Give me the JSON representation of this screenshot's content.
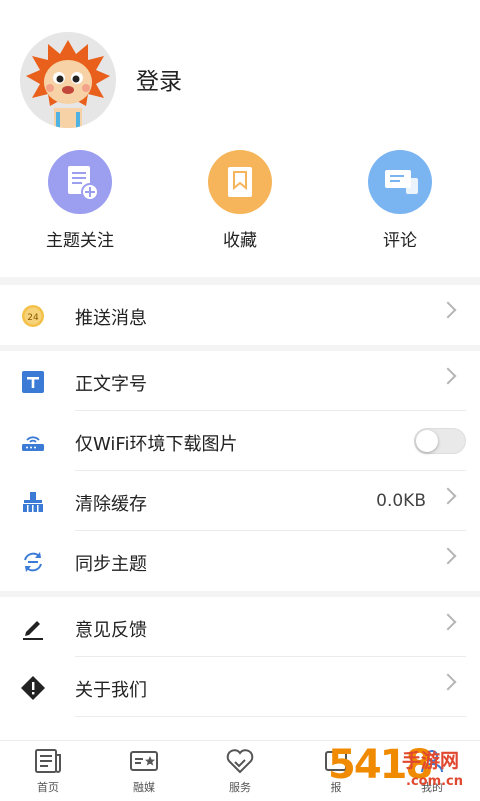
{
  "profile": {
    "login_label": "登录"
  },
  "quick_actions": [
    {
      "label": "主题关注",
      "icon": "document-add-icon",
      "color": "#9c9ef0"
    },
    {
      "label": "收藏",
      "icon": "bookmark-icon",
      "color": "#f6b55a"
    },
    {
      "label": "评论",
      "icon": "chat-icon",
      "color": "#7ab5f2"
    }
  ],
  "settings": {
    "push": {
      "label": "推送消息",
      "icon": "clock-24-icon"
    },
    "font_size": {
      "label": "正文字号",
      "icon": "text-t-icon"
    },
    "wifi_only": {
      "label": "仅WiFi环境下载图片",
      "icon": "router-icon",
      "enabled": false
    },
    "clear_cache": {
      "label": "清除缓存",
      "value": "0.0KB",
      "icon": "broom-icon"
    },
    "sync_theme": {
      "label": "同步主题",
      "icon": "sync-icon"
    },
    "feedback": {
      "label": "意见反馈",
      "icon": "pencil-icon"
    },
    "about": {
      "label": "关于我们",
      "icon": "warning-diamond-icon"
    }
  },
  "tabs": [
    {
      "label": "首页",
      "icon": "newspaper-icon"
    },
    {
      "label": "融媒",
      "icon": "media-card-icon"
    },
    {
      "label": "服务",
      "icon": "heart-service-icon"
    },
    {
      "label": "报",
      "icon": "report-icon"
    },
    {
      "label": "我的",
      "icon": "user-icon"
    }
  ],
  "watermark": {
    "number": "5418",
    "site_name": "手游网",
    "domain": ".com.cn"
  },
  "colors": {
    "accent_purple": "#9c9ef0",
    "accent_orange": "#f6b55a",
    "accent_blue": "#7ab5f2",
    "icon_blue": "#3b7bd6"
  }
}
